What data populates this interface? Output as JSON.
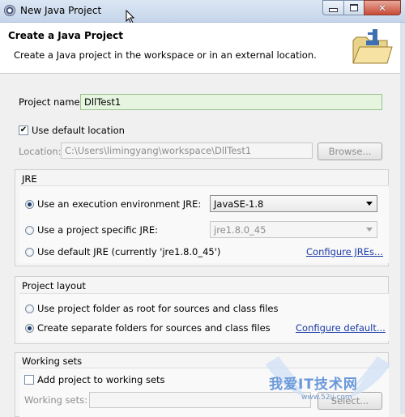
{
  "window": {
    "title": "New Java Project"
  },
  "header": {
    "title": "Create a Java Project",
    "description": "Create a Java project in the workspace or in an external location."
  },
  "project": {
    "name_label": "Project name:",
    "name_value": "DllTest1",
    "use_default_label": "Use default location",
    "use_default_checked": true,
    "location_label": "Location:",
    "location_value": "C:\\Users\\limingyang\\workspace\\DllTest1",
    "browse_label": "Browse..."
  },
  "jre": {
    "group_label": "JRE",
    "option_env_label": "Use an execution environment JRE:",
    "env_selected": "JavaSE-1.8",
    "option_specific_label": "Use a project specific JRE:",
    "specific_selected": "jre1.8.0_45",
    "option_default_label": "Use default JRE (currently 'jre1.8.0_45')",
    "configure_link": "Configure JREs..."
  },
  "layout": {
    "group_label": "Project layout",
    "option_root_label": "Use project folder as root for sources and class files",
    "option_separate_label": "Create separate folders for sources and class files",
    "configure_link": "Configure default..."
  },
  "working_sets": {
    "group_label": "Working sets",
    "add_label": "Add project to working sets",
    "add_checked": false,
    "sets_label": "Working sets:",
    "select_label": "Select..."
  },
  "watermark": {
    "text": "我爱IT技术网",
    "url_text": "www.52ij.com"
  },
  "colors": {
    "name_field_bg": "#e6f5e0",
    "link": "#1a3aa8",
    "header_bg": "#ffffff"
  }
}
